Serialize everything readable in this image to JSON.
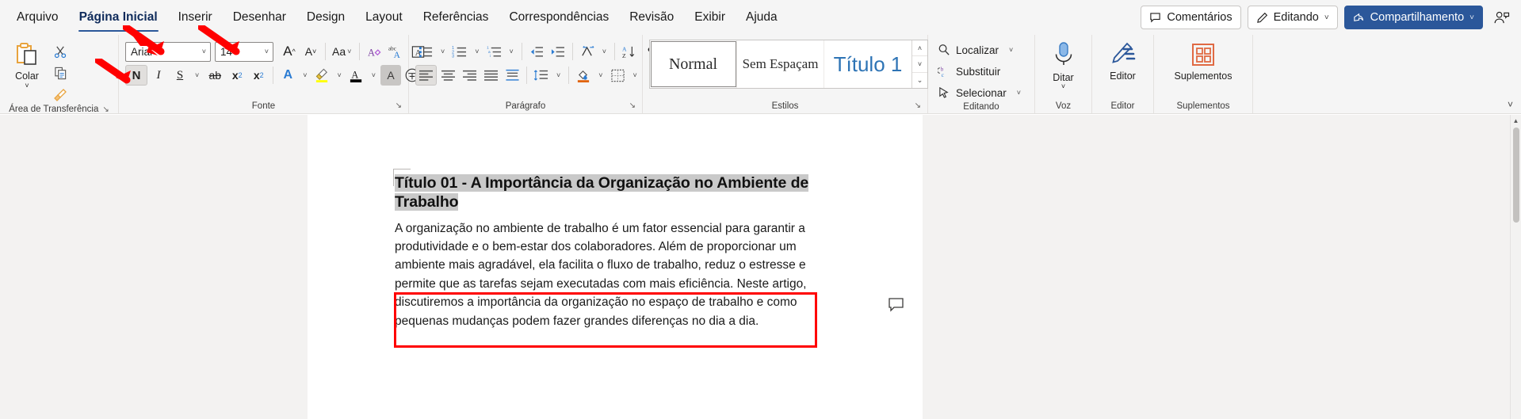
{
  "tabs": [
    {
      "label": "Arquivo",
      "active": false
    },
    {
      "label": "Página Inicial",
      "active": true
    },
    {
      "label": "Inserir",
      "active": false
    },
    {
      "label": "Desenhar",
      "active": false
    },
    {
      "label": "Design",
      "active": false
    },
    {
      "label": "Layout",
      "active": false
    },
    {
      "label": "Referências",
      "active": false
    },
    {
      "label": "Correspondências",
      "active": false
    },
    {
      "label": "Revisão",
      "active": false
    },
    {
      "label": "Exibir",
      "active": false
    },
    {
      "label": "Ajuda",
      "active": false
    }
  ],
  "header": {
    "comments_label": "Comentários",
    "editing_label": "Editando",
    "share_label": "Compartilhamento",
    "caret": "˅",
    "accent": "#2b579a"
  },
  "ribbon": {
    "clipboard": {
      "group_label": "Área de Transferência",
      "paste_label": "Colar",
      "paste_caret": "˅",
      "dialog_launcher": "↘"
    },
    "font": {
      "group_label": "Fonte",
      "font_name": "Arial",
      "font_size": "14",
      "grow_label": "A",
      "shrink_label": "A",
      "case_label": "Aa",
      "bold_label": "N",
      "italic_label": "I",
      "underline_label": "S",
      "strike_label": "ab",
      "subscript_label": "x",
      "superscript_label": "x",
      "text_effects_label": "A",
      "highlight_label": "A",
      "fontcolor_label": "A",
      "charshading_label": "A",
      "dialog_launcher": "↘",
      "caret": "˅"
    },
    "paragraph": {
      "group_label": "Parágrafo",
      "dialog_launcher": "↘",
      "caret": "˅",
      "pilcrow": "¶"
    },
    "styles": {
      "group_label": "Estilos",
      "items": [
        {
          "name": "Normal",
          "selected": true
        },
        {
          "name": "Sem Espaçam",
          "selected": false
        },
        {
          "name": "Título 1",
          "selected": false
        }
      ],
      "dialog_launcher": "↘",
      "scroll_up": "˄",
      "scroll_down": "˅",
      "scroll_more": "⌄"
    },
    "editing": {
      "group_label": "Editando",
      "find_label": "Localizar",
      "replace_label": "Substituir",
      "select_label": "Selecionar",
      "caret": "˅"
    },
    "voice": {
      "group_label": "Voz",
      "dictate_label": "Ditar",
      "caret": "˅"
    },
    "editor": {
      "group_label": "Editor",
      "editor_label": "Editor"
    },
    "addins": {
      "group_label": "Suplementos",
      "addins_label": "Suplementos"
    },
    "collapse_caret": "˅"
  },
  "document": {
    "heading_line1": "Título 01 - A Importância da Organização no Ambiente de",
    "heading_line2": "Trabalho",
    "paragraph": "A organização no ambiente de trabalho é um fator essencial para garantir a produtividade e o bem-estar dos colaboradores. Além de proporcionar um ambiente mais agradável, ela facilita o fluxo de trabalho, reduz o estresse e permite que as tarefas sejam executadas com mais eficiência. Neste artigo, discutiremos a importância da organização no espaço de trabalho e como pequenas mudanças podem fazer grandes diferenças no dia a dia.",
    "selection_color": "#c9c9c9",
    "annotation_color": "#ff0000"
  },
  "scrollbar": {
    "up_arrow": "▲",
    "down_arrow": "▼"
  }
}
